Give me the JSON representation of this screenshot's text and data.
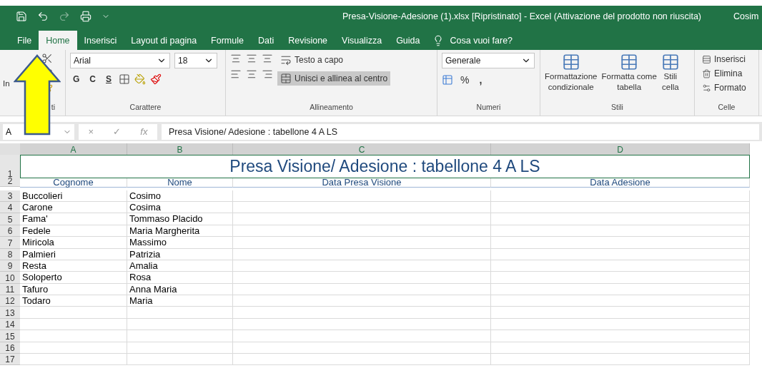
{
  "window": {
    "title": "Presa-Visione-Adesione (1).xlsx [Ripristinato]  -  Excel (Attivazione del prodotto non riuscita)",
    "user": "Cosim"
  },
  "tabs": [
    {
      "label": "File",
      "selected": false
    },
    {
      "label": "Home",
      "selected": true
    },
    {
      "label": "Inserisci",
      "selected": false
    },
    {
      "label": "Layout di pagina",
      "selected": false
    },
    {
      "label": "Formule",
      "selected": false
    },
    {
      "label": "Dati",
      "selected": false
    },
    {
      "label": "Revisione",
      "selected": false
    },
    {
      "label": "Visualizza",
      "selected": false
    },
    {
      "label": "Guida",
      "selected": false
    }
  ],
  "tell_me": {
    "placeholder": "Cosa vuoi fare?"
  },
  "ribbon": {
    "clipboard": {
      "paste": "In",
      "label": "ti"
    },
    "font": {
      "name": "Arial",
      "size": "18",
      "bold": "G",
      "italic": "C",
      "underline": "S",
      "label": "Carattere"
    },
    "alignment": {
      "wrap": "Testo a capo",
      "merge": "Unisci e allinea al centro",
      "label": "Allineamento"
    },
    "number": {
      "format": "Generale",
      "percent": "%",
      "comma": ",",
      "label": "Numeri"
    },
    "styles": {
      "buttons": [
        {
          "lines": [
            "Formattazione",
            "condizionale"
          ]
        },
        {
          "lines": [
            "Formatta come",
            "tabella"
          ]
        },
        {
          "lines": [
            "Stili",
            "cella"
          ]
        }
      ],
      "label": "Stili"
    },
    "cells": {
      "items": [
        "Inserisci",
        "Elimina",
        "Formato"
      ],
      "label": "Celle"
    }
  },
  "formula_bar": {
    "name_box": "A",
    "cancel": "×",
    "enter": "✓",
    "function": "fx",
    "formula": "Presa Visione/ Adesione : tabellone 4 A LS"
  },
  "sheet": {
    "columns": [
      {
        "label": "A",
        "selected": true
      },
      {
        "label": "B",
        "selected": true
      },
      {
        "label": "C",
        "selected": true
      },
      {
        "label": "D",
        "selected": true
      }
    ],
    "title_row": {
      "number": "1",
      "title": "Presa Visione/ Adesione : tabellone 4 A LS"
    },
    "header_row": {
      "number": "2",
      "headers": [
        "Cognome",
        "Nome",
        "Data Presa Visione",
        "Data Adesione"
      ]
    },
    "rows": [
      {
        "number": "3",
        "cells": [
          "Buccolieri",
          "Cosimo"
        ]
      },
      {
        "number": "4",
        "cells": [
          "Carone",
          "Cosima"
        ]
      },
      {
        "number": "5",
        "cells": [
          "Fama'",
          "Tommaso Placido"
        ]
      },
      {
        "number": "6",
        "cells": [
          "Fedele",
          "Maria Margherita"
        ]
      },
      {
        "number": "7",
        "cells": [
          "Miricola",
          "Massimo"
        ]
      },
      {
        "number": "8",
        "cells": [
          "Palmieri",
          "Patrizia"
        ]
      },
      {
        "number": "9",
        "cells": [
          "Resta",
          "Amalia"
        ]
      },
      {
        "number": "10",
        "cells": [
          "Soloperto",
          "Rosa"
        ]
      },
      {
        "number": "11",
        "cells": [
          "Tafuro",
          "Anna Maria"
        ]
      },
      {
        "number": "12",
        "cells": [
          "Todaro",
          "Maria"
        ]
      },
      {
        "number": "13"
      },
      {
        "number": "14"
      },
      {
        "number": "15"
      },
      {
        "number": "16"
      },
      {
        "number": "17"
      }
    ]
  }
}
